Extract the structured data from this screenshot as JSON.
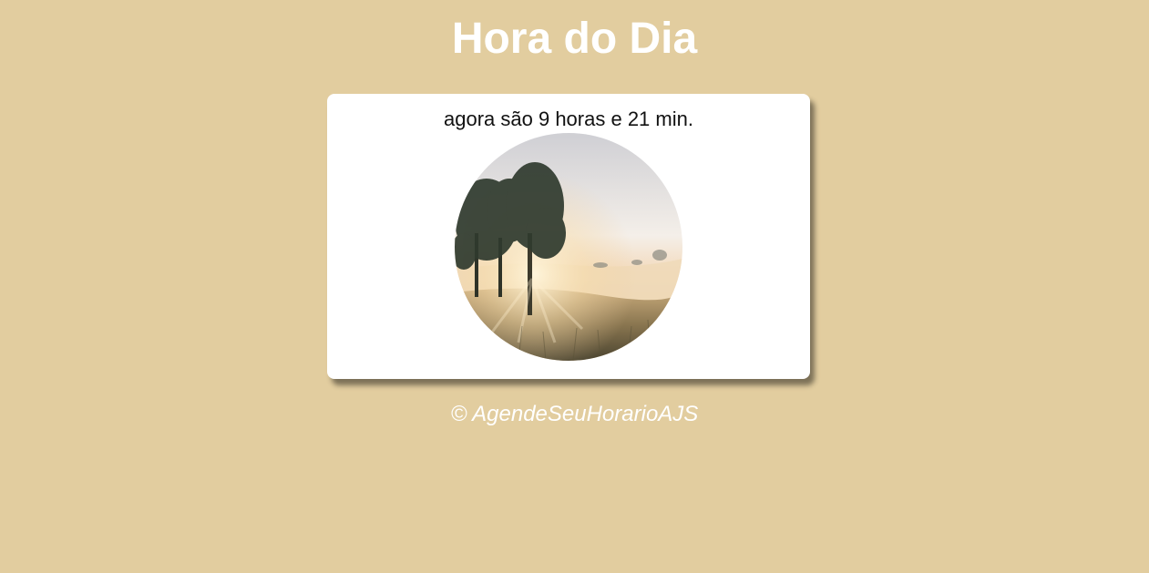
{
  "header": {
    "title": "Hora do Dia"
  },
  "card": {
    "time_text": "agora são 9 horas e 21 min.",
    "image_alt": "morning-tree-photo"
  },
  "footer": {
    "copyright": "© AgendeSeuHorarioAJS"
  },
  "colors": {
    "background": "#e2cd9f",
    "card": "#ffffff",
    "title": "#ffffff"
  }
}
